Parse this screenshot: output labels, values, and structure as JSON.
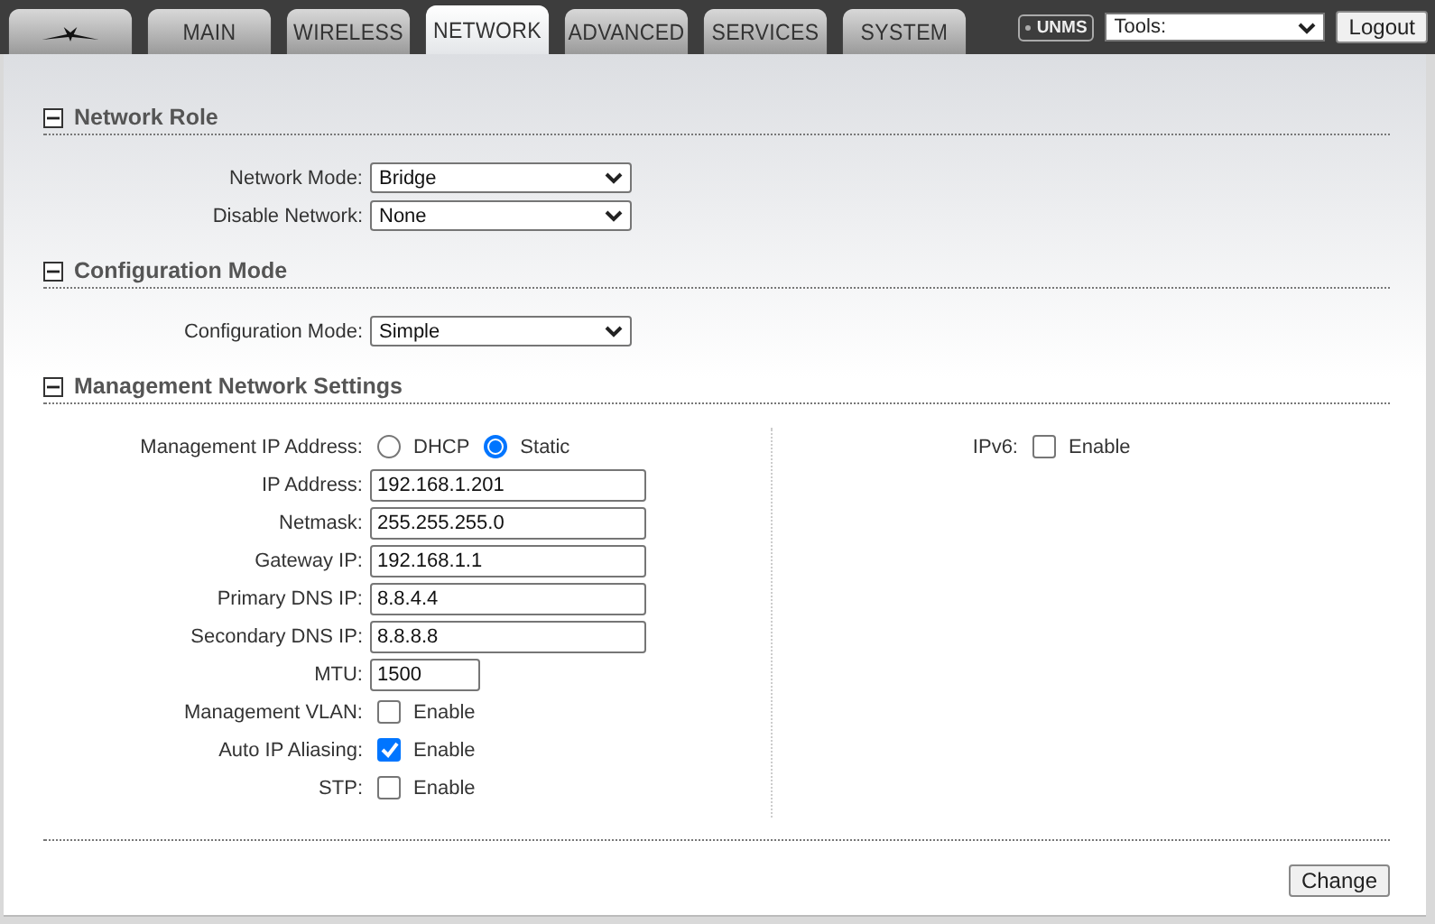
{
  "header": {
    "tabs": [
      {
        "kind": "logo",
        "selected": false
      },
      {
        "kind": "text",
        "label": "MAIN",
        "selected": false
      },
      {
        "kind": "text",
        "label": "WIRELESS",
        "selected": false
      },
      {
        "kind": "text",
        "label": "NETWORK",
        "selected": true
      },
      {
        "kind": "text",
        "label": "ADVANCED",
        "selected": false
      },
      {
        "kind": "text",
        "label": "SERVICES",
        "selected": false
      },
      {
        "kind": "text",
        "label": "SYSTEM",
        "selected": false
      }
    ],
    "unms": "UNMS",
    "tools": {
      "value": "Tools:"
    },
    "logout": "Logout"
  },
  "sections": [
    {
      "title": "Network Role",
      "expanded": true,
      "rows": [
        {
          "kind": "select",
          "label": "Network Mode:",
          "value": "Bridge"
        },
        {
          "kind": "select",
          "label": "Disable Network:",
          "value": "None"
        }
      ]
    },
    {
      "title": "Configuration Mode",
      "expanded": true,
      "rows": [
        {
          "kind": "select",
          "label": "Configuration Mode:",
          "value": "Simple"
        }
      ]
    },
    {
      "title": "Management Network Settings",
      "expanded": true,
      "rows": [
        {
          "kind": "radio",
          "label": "Management IP Address:",
          "options": [
            {
              "label": "DHCP",
              "selected": false
            },
            {
              "label": "Static",
              "selected": true
            }
          ]
        },
        {
          "kind": "text",
          "label": "IP Address:",
          "value": "192.168.1.201"
        },
        {
          "kind": "text",
          "label": "Netmask:",
          "value": "255.255.255.0"
        },
        {
          "kind": "text",
          "label": "Gateway IP:",
          "value": "192.168.1.1"
        },
        {
          "kind": "text",
          "label": "Primary DNS IP:",
          "value": "8.8.4.4"
        },
        {
          "kind": "text",
          "label": "Secondary DNS IP:",
          "value": "8.8.8.8"
        },
        {
          "kind": "short",
          "label": "MTU:",
          "value": "1500"
        },
        {
          "kind": "checkbox",
          "label": "Management VLAN:",
          "option": "Enable",
          "checked": false
        },
        {
          "kind": "checkbox",
          "label": "Auto IP Aliasing:",
          "option": "Enable",
          "checked": true
        },
        {
          "kind": "checkbox",
          "label": "STP:",
          "option": "Enable",
          "checked": false
        }
      ],
      "side_rows": [
        {
          "kind": "checkbox",
          "label": "IPv6:",
          "option": "Enable",
          "checked": false
        }
      ]
    }
  ],
  "footer": {
    "button": "Change"
  }
}
